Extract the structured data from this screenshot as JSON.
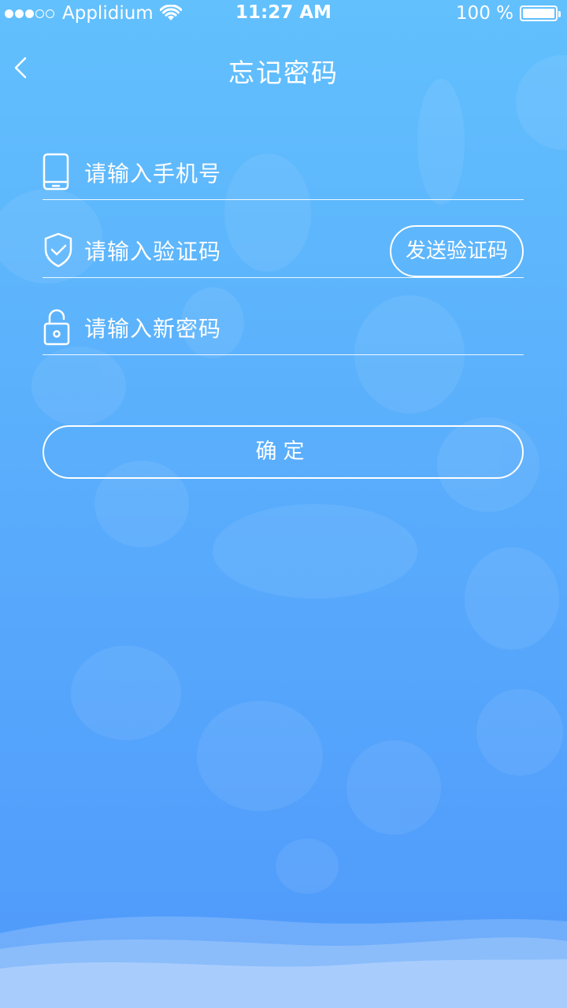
{
  "status_bar": {
    "carrier": "Applidium",
    "time": "11:27 AM",
    "battery": "100 %"
  },
  "nav": {
    "title": "忘记密码",
    "back_icon": "chevron-left-icon"
  },
  "form": {
    "phone": {
      "placeholder": "请输入手机号",
      "value": "",
      "icon": "phone-icon"
    },
    "code": {
      "placeholder": "请输入验证码",
      "value": "",
      "icon": "shield-check-icon",
      "send_label": "发送验证码"
    },
    "password": {
      "placeholder": "请输入新密码",
      "value": "",
      "icon": "lock-icon"
    }
  },
  "confirm_label": "确定",
  "colors": {
    "gradient_top": "#62c0fd",
    "gradient_bottom": "#4f99fb",
    "foreground": "#ffffff"
  }
}
